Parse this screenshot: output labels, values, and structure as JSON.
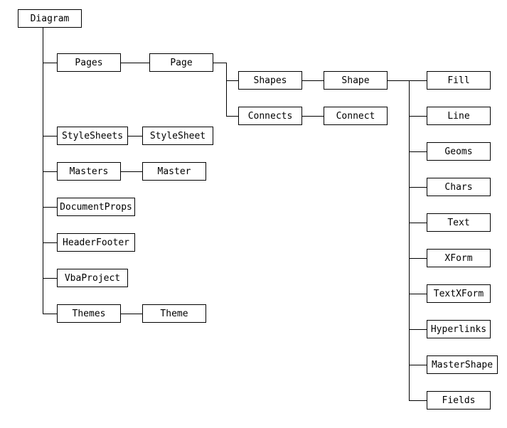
{
  "root": "Diagram",
  "level1": {
    "pages": "Pages",
    "stylesheets": "StyleSheets",
    "masters": "Masters",
    "documentprops": "DocumentProps",
    "headerfooter": "HeaderFooter",
    "vbaproject": "VbaProject",
    "themes": "Themes"
  },
  "level2": {
    "page": "Page",
    "stylesheet": "StyleSheet",
    "master": "Master",
    "theme": "Theme"
  },
  "level3": {
    "shapes": "Shapes",
    "connects": "Connects"
  },
  "level4": {
    "shape": "Shape",
    "connect": "Connect"
  },
  "level5": {
    "fill": "Fill",
    "line": "Line",
    "geoms": "Geoms",
    "chars": "Chars",
    "text": "Text",
    "xform": "XForm",
    "textxform": "TextXForm",
    "hyperlinks": "Hyperlinks",
    "mastershape": "MasterShape",
    "fields": "Fields"
  }
}
